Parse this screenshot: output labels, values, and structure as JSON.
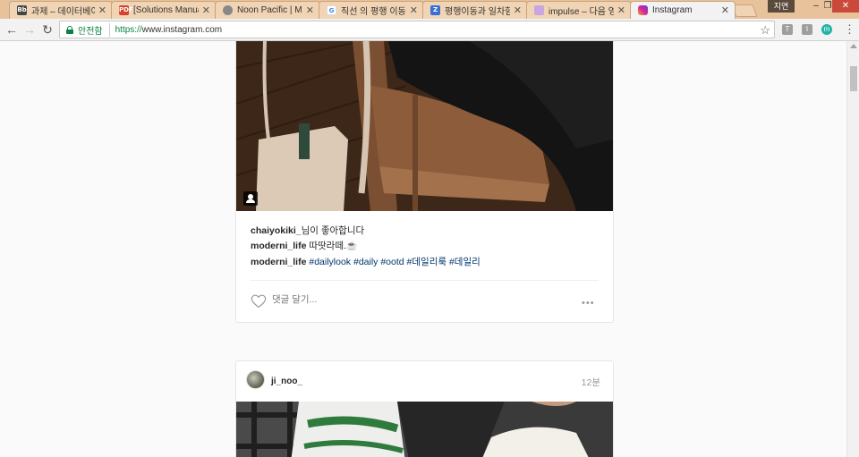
{
  "browser": {
    "tabs": [
      {
        "title": "과제 – 데이터베이스",
        "favicon": "Bb"
      },
      {
        "title": "[Solutions Manual]",
        "favicon": "PDF"
      },
      {
        "title": "Noon Pacific | Mu",
        "favicon": "wave"
      },
      {
        "title": "직선 의 평행 이동",
        "favicon": "G"
      },
      {
        "title": "평행이동과 일차함",
        "favicon": "Z"
      },
      {
        "title": "impulse – 다음 영",
        "favicon": "dict"
      },
      {
        "title": "Instagram",
        "favicon": "instagram"
      }
    ],
    "profile_label": "지연",
    "secure_label": "안전함",
    "url_scheme": "https://",
    "url_host": "www.instagram.com",
    "extensions": [
      "T",
      "I",
      "m"
    ]
  },
  "post1": {
    "likes_user": "chaiyokiki_",
    "likes_suffix": "님이 좋아합니다",
    "caption1_user": "moderni_life",
    "caption1_text": "따땃라떼.☕",
    "caption2_user": "moderni_life",
    "hashtags": [
      "#dailylook",
      "#daily",
      "#ootd",
      "#데일리룩",
      "#데일리"
    ],
    "comment_placeholder": "댓글 달기...",
    "more_label": "•••"
  },
  "post2": {
    "username": "ji_noo_",
    "time": "12분"
  },
  "colors": {
    "tabbar": "#e8c29a",
    "link_blue": "#003569",
    "secure_green": "#0b8043"
  }
}
